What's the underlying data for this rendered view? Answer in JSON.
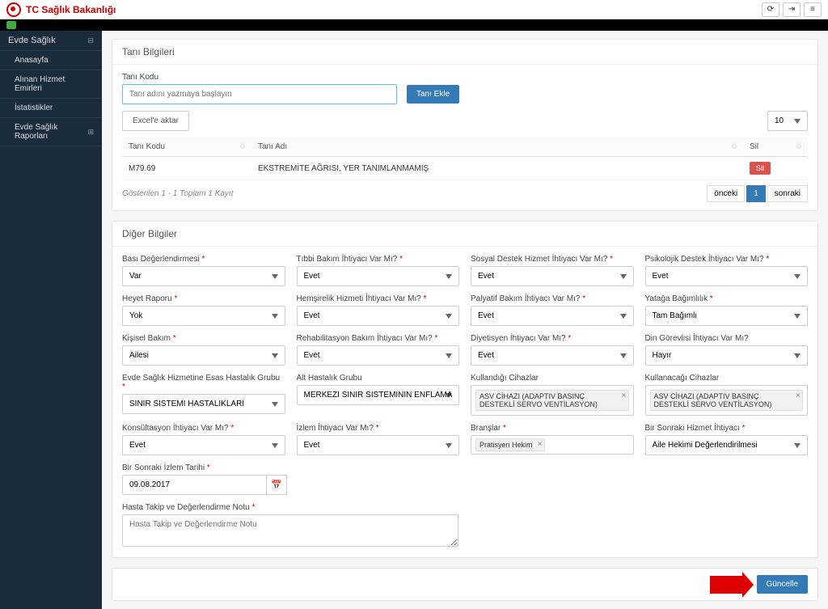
{
  "header": {
    "title": "TC Sağlık Bakanlığı"
  },
  "sidebar": {
    "items": [
      {
        "label": "Evde Sağlık"
      },
      {
        "label": "Anasayfa"
      },
      {
        "label": "Alınan Hizmet Emirleri"
      },
      {
        "label": "İstatistikler"
      },
      {
        "label": "Evde Sağlık Raporları"
      }
    ]
  },
  "tani": {
    "panel_title": "Tanı Bilgileri",
    "kod_label": "Tanı Kodu",
    "placeholder": "Tanı adını yazmaya başlayın",
    "add_btn": "Tanı Ekle",
    "export_btn": "Excel'e aktar",
    "cols": {
      "kod": "Tanı Kodu",
      "ad": "Tanı Adı",
      "sil": "Sil"
    },
    "rows": [
      {
        "kod": "M79.69",
        "ad": "EKSTREMİTE AĞRISI, YER TANIMLANMAMIŞ",
        "sil": "Sil"
      }
    ],
    "info": "Gösterilen 1 - 1 Toplam 1 Kayıt",
    "page_size": "10",
    "prev": "önceki",
    "next": "sonraki",
    "page": "1"
  },
  "diger": {
    "panel_title": "Diğer Bilgiler",
    "fields": {
      "basi": {
        "label": "Bası Değerlendirmesi",
        "value": "Var"
      },
      "tibbi": {
        "label": "Tıbbi Bakım İhtiyacı Var Mı?",
        "value": "Evet"
      },
      "sosyal": {
        "label": "Sosyal Destek Hizmet İhtiyacı Var Mı?",
        "value": "Evet"
      },
      "psiko": {
        "label": "Psikolojik Destek İhtiyacı Var Mı?",
        "value": "Evet"
      },
      "heyet": {
        "label": "Heyet Raporu",
        "value": "Yok"
      },
      "hemsire": {
        "label": "Hemşirelik Hizmeti İhtiyacı Var Mı?",
        "value": "Evet"
      },
      "palyatif": {
        "label": "Palyatif Bakım İhtiyacı Var Mı?",
        "value": "Evet"
      },
      "yataga": {
        "label": "Yatağa Bağımlılık",
        "value": "Tam Bağımlı"
      },
      "kisisel": {
        "label": "Kişisel Bakım",
        "value": "Ailesi"
      },
      "rehab": {
        "label": "Rehabilitasyon Bakım İhtiyacı Var Mı?",
        "value": "Evet"
      },
      "diyet": {
        "label": "Diyetisyen İhtiyacı Var Mı?",
        "value": "Evet"
      },
      "din": {
        "label": "Din Görevlisi İhtiyacı Var Mı?",
        "value": "Hayır"
      },
      "esas": {
        "label": "Evde Sağlık Hizmetine Esas Hastalık Grubu",
        "value": "SİNİR SİSTEMİ HASTALIKLARI"
      },
      "alt": {
        "label": "Alt Hastalık Grubu",
        "value": "MERKEZİ SİNİR SİSTEMİNİN ENFLAMATUVAR HASTALIKL"
      },
      "kullandigi": {
        "label": "Kullandığı Cihazlar",
        "tag": "ASV CİHAZI (ADAPTIV BASINÇ DESTEKLİ SERVO VENTİLASYON)"
      },
      "kullanacagi": {
        "label": "Kullanacağı Cihazlar",
        "tag": "ASV CİHAZI (ADAPTIV BASINÇ DESTEKLİ SERVO VENTİLASYON)"
      },
      "konsul": {
        "label": "Konsültasyon İhtiyacı Var Mı?",
        "value": "Evet"
      },
      "izlem": {
        "label": "İzlem İhtiyacı Var Mı?",
        "value": "Evet"
      },
      "brans": {
        "label": "Branşlar",
        "tag": "Pratisyen Hekim"
      },
      "sonraki_hizmet": {
        "label": "Bir Sonraki Hizmet İhtiyacı",
        "value": "Aile Hekimi Değerlendirilmesi"
      },
      "sonraki_tarih": {
        "label": "Bir Sonraki İzlem Tarihi",
        "value": "09.08.2017"
      },
      "not": {
        "label": "Hasta Takip ve Değerlendirme Notu",
        "placeholder": "Hasta Takip ve Değerlendirme Notu"
      }
    }
  },
  "footer": {
    "update": "Güncelle"
  }
}
